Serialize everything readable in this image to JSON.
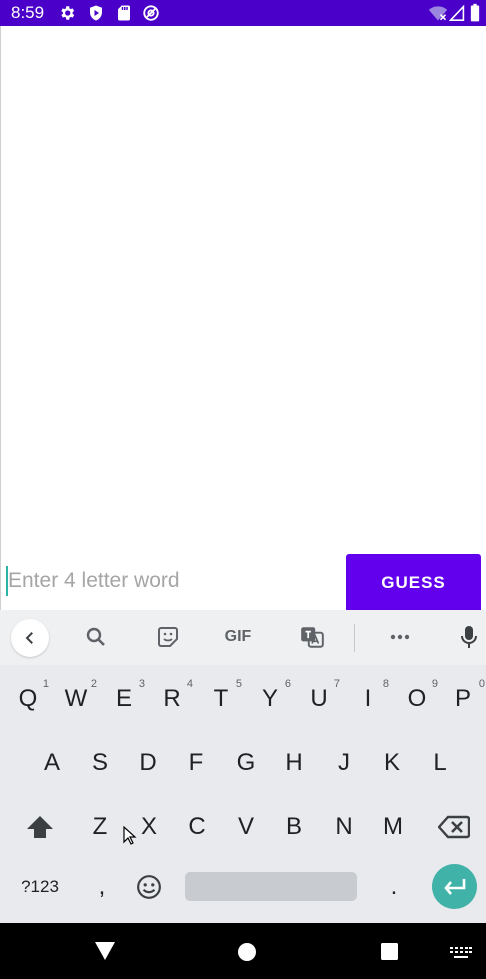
{
  "status_bar": {
    "time": "8:59",
    "background": "#4a00c8",
    "left_icons": [
      "gear-icon",
      "shield-icon",
      "sd-card-icon",
      "at-sign-icon"
    ],
    "right_icons": [
      "wifi-off-icon",
      "signal-icon",
      "battery-icon"
    ]
  },
  "app": {
    "input_placeholder": "Enter 4 letter word",
    "input_value": "",
    "guess_button_label": "GUESS",
    "accent_color": "#6200ee"
  },
  "keyboard": {
    "toolbar_icons": [
      "chevron-left-icon",
      "search-icon",
      "sticker-icon",
      "gif-icon",
      "translate-icon",
      "more-icon",
      "mic-icon"
    ],
    "gif_label": "GIF",
    "row1": [
      {
        "label": "Q",
        "hint": "1"
      },
      {
        "label": "W",
        "hint": "2"
      },
      {
        "label": "E",
        "hint": "3"
      },
      {
        "label": "R",
        "hint": "4"
      },
      {
        "label": "T",
        "hint": "5"
      },
      {
        "label": "Y",
        "hint": "6"
      },
      {
        "label": "U",
        "hint": "7"
      },
      {
        "label": "I",
        "hint": "8"
      },
      {
        "label": "O",
        "hint": "9"
      },
      {
        "label": "P",
        "hint": "0"
      }
    ],
    "row2": [
      "A",
      "S",
      "D",
      "F",
      "G",
      "H",
      "J",
      "K",
      "L"
    ],
    "row3": [
      "Z",
      "X",
      "C",
      "V",
      "B",
      "N",
      "M"
    ],
    "symbols_label": "?123",
    "comma_label": ",",
    "period_label": ".",
    "enter_color": "#41b2a7"
  },
  "nav_bar": {
    "icons": [
      "back-triangle-icon",
      "home-circle-icon",
      "recents-square-icon",
      "keyboard-switch-icon"
    ]
  }
}
